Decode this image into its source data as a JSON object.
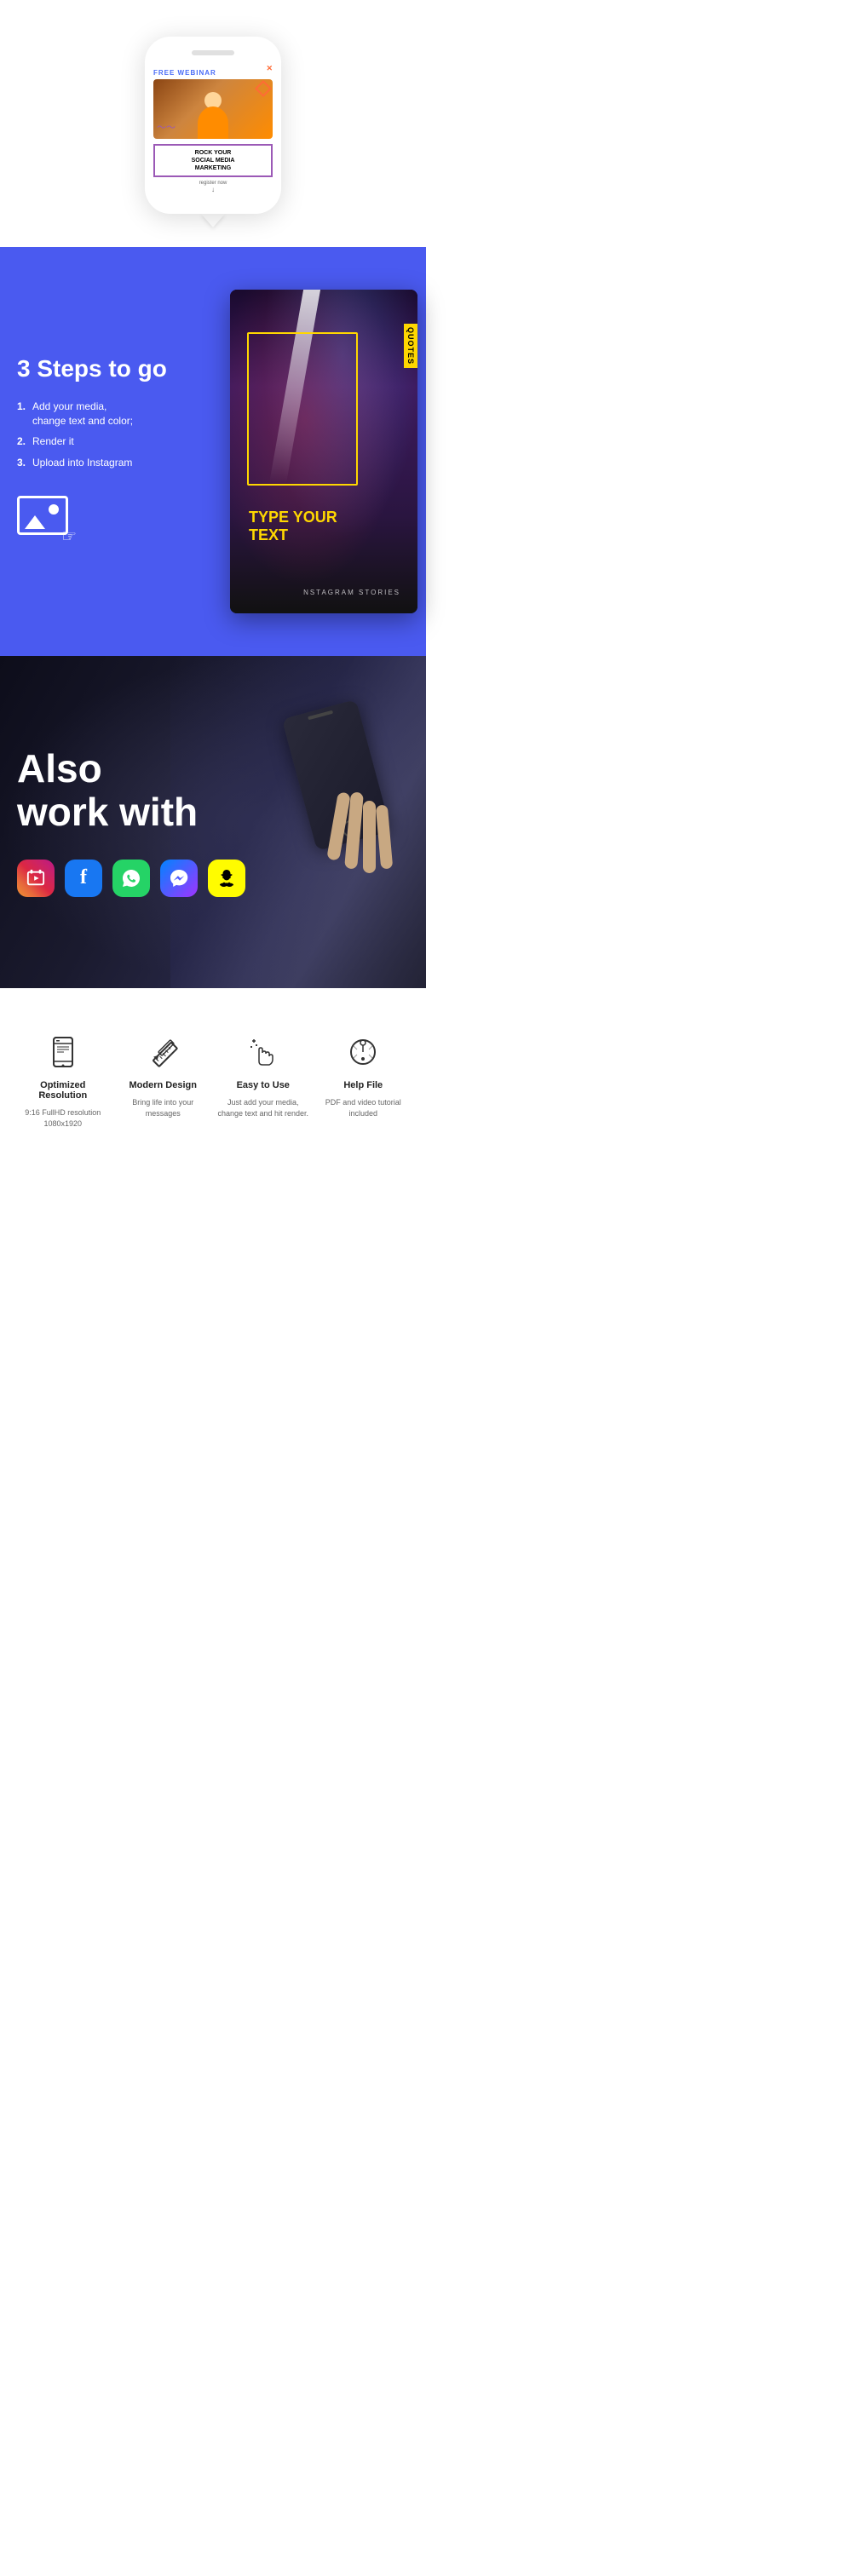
{
  "phone_section": {
    "webinar_label": "FREE WEBINAR",
    "title_line1": "ROCK YOUR",
    "title_line2": "SOCIAL MEDIA",
    "title_line3": "MARKETING",
    "register_text": "register now"
  },
  "steps_section": {
    "title": "3 Steps to go",
    "steps": [
      {
        "num": "1.",
        "text": "Add your media, change text and color;"
      },
      {
        "num": "2.",
        "text": "Render it"
      },
      {
        "num": "3.",
        "text": "Upload into Instagram"
      }
    ],
    "story_card": {
      "quotes_badge": "QUOTES",
      "type_text_line1": "TYPE YOUR",
      "type_text_line2": "TEXT",
      "footer": "NSTAGRAM STORIES"
    }
  },
  "also_section": {
    "title_line1": "Also",
    "title_line2": "work with",
    "social_platforms": [
      {
        "name": "IGTV",
        "color_class": "social-igtv",
        "symbol": "▶"
      },
      {
        "name": "Facebook",
        "color_class": "social-fb",
        "symbol": "f"
      },
      {
        "name": "WhatsApp",
        "color_class": "social-wa",
        "symbol": "✆"
      },
      {
        "name": "Messenger",
        "color_class": "social-messenger",
        "symbol": "⌁"
      },
      {
        "name": "Snapchat",
        "color_class": "social-snap social-snap-text",
        "symbol": "👻"
      }
    ]
  },
  "features_section": {
    "features": [
      {
        "icon": "phone-resolution",
        "title": "Optimized Resolution",
        "desc": "9:16 FullHD resolution 1080x1920"
      },
      {
        "icon": "pencil-ruler",
        "title": "Modern Design",
        "desc": "Bring life into your messages"
      },
      {
        "icon": "sparkle-hand",
        "title": "Easy to Use",
        "desc": "Just add your media, change text and hit render."
      },
      {
        "icon": "help-circle",
        "title": "Help File",
        "desc": "PDF and video tutorial included"
      }
    ]
  }
}
